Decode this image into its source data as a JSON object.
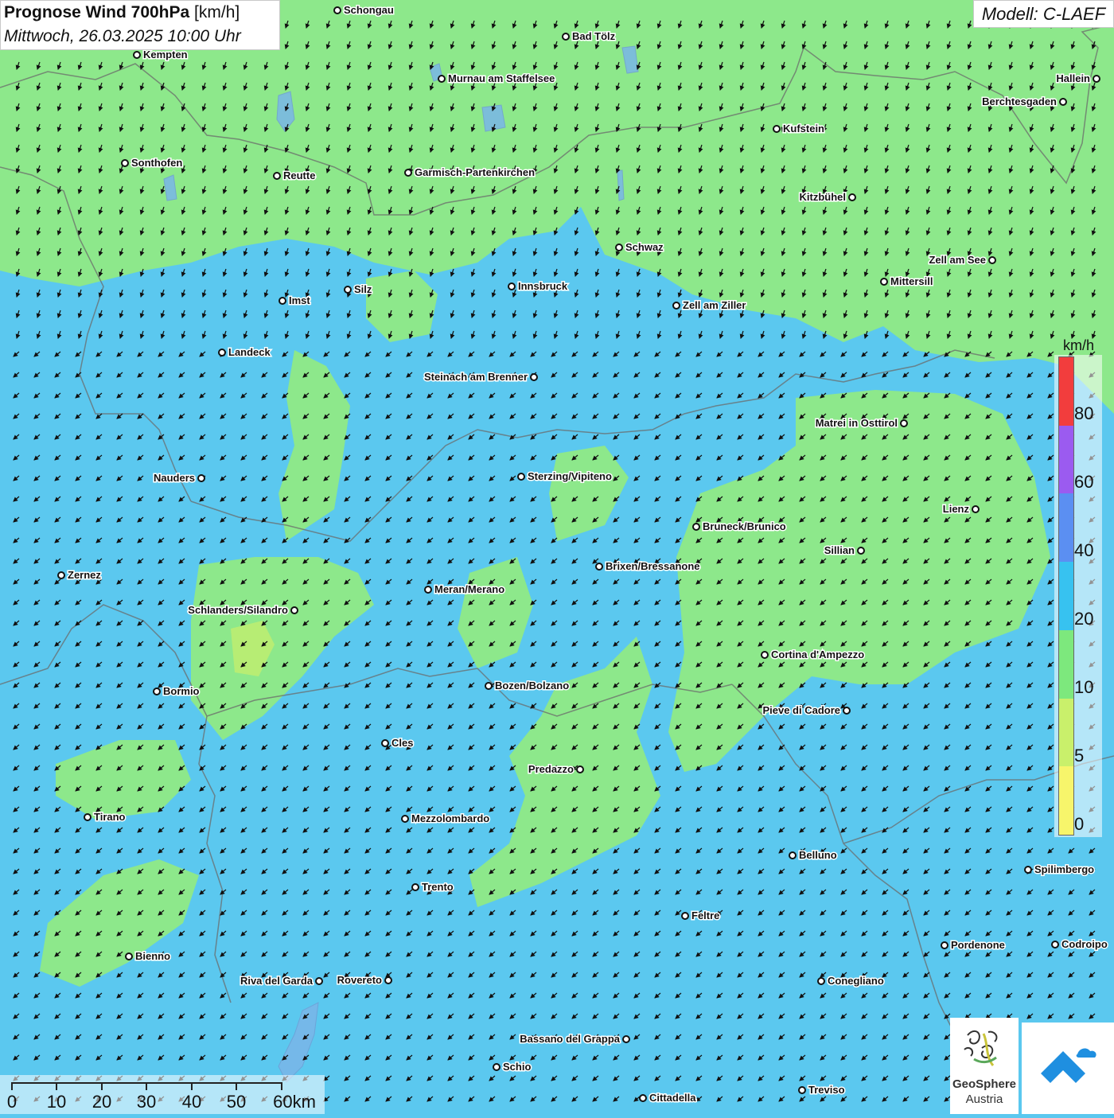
{
  "title": {
    "main": "Prognose Wind 700hPa",
    "unit": "[km/h]",
    "date": "Mittwoch, 26.03.2025 10:00 Uhr"
  },
  "model": "Modell: C-LAEF",
  "legend": {
    "unit": "km/h",
    "labels": [
      "80",
      "60",
      "40",
      "20",
      "10",
      "5",
      "0"
    ],
    "colors": [
      "#f23d3d",
      "#9b5bf0",
      "#5b8ff2",
      "#37c2f0",
      "#7de87d",
      "#c9f06b",
      "#f7f56b"
    ]
  },
  "scalebar": {
    "labels": [
      "0",
      "10",
      "20",
      "30",
      "40",
      "50",
      "60km"
    ]
  },
  "logos": {
    "geosphere_line1": "GeoSphere",
    "geosphere_line2": "Austria"
  },
  "colors": {
    "low_wind": "#8de88b",
    "mid_wind": "#5bc8ef",
    "border": "#6b6b6b",
    "water": "#7ab6e8"
  },
  "cities": [
    {
      "name": "Schongau"
    },
    {
      "name": "Bad Tölz"
    },
    {
      "name": "Kempten"
    },
    {
      "name": "Murnau am Staffelsee"
    },
    {
      "name": "Hallein"
    },
    {
      "name": "Berchtesgaden"
    },
    {
      "name": "Kufstein"
    },
    {
      "name": "Sonthofen"
    },
    {
      "name": "Reutte"
    },
    {
      "name": "Garmisch-Partenkirchen"
    },
    {
      "name": "Kitzbühel"
    },
    {
      "name": "Schwaz"
    },
    {
      "name": "Zell am See"
    },
    {
      "name": "Mittersill"
    },
    {
      "name": "Innsbruck"
    },
    {
      "name": "Silz"
    },
    {
      "name": "Imst"
    },
    {
      "name": "Zell am Ziller"
    },
    {
      "name": "Landeck"
    },
    {
      "name": "Steinach am Brenner"
    },
    {
      "name": "Matrei in Osttirol"
    },
    {
      "name": "Nauders"
    },
    {
      "name": "Sterzing/Vipiteno"
    },
    {
      "name": "Lienz"
    },
    {
      "name": "Bruneck/Brunico"
    },
    {
      "name": "Sillian"
    },
    {
      "name": "Brixen/Bressanone"
    },
    {
      "name": "Zernez"
    },
    {
      "name": "Meran/Merano"
    },
    {
      "name": "Schlanders/Silandro"
    },
    {
      "name": "Cortina d'Ampezzo"
    },
    {
      "name": "Bozen/Bolzano"
    },
    {
      "name": "Bormio"
    },
    {
      "name": "Pieve di Cadore"
    },
    {
      "name": "Cles"
    },
    {
      "name": "Predazzo"
    },
    {
      "name": "Tirano"
    },
    {
      "name": "Mezzolombardo"
    },
    {
      "name": "Belluno"
    },
    {
      "name": "Spilimbergo"
    },
    {
      "name": "Trento"
    },
    {
      "name": "Feltre"
    },
    {
      "name": "Pordenone"
    },
    {
      "name": "Codroipo"
    },
    {
      "name": "Bienno"
    },
    {
      "name": "Riva del Garda"
    },
    {
      "name": "Rovereto"
    },
    {
      "name": "Conegliano"
    },
    {
      "name": "Bassano del Grappa"
    },
    {
      "name": "Schio"
    },
    {
      "name": "Treviso"
    },
    {
      "name": "Cittadella"
    }
  ]
}
